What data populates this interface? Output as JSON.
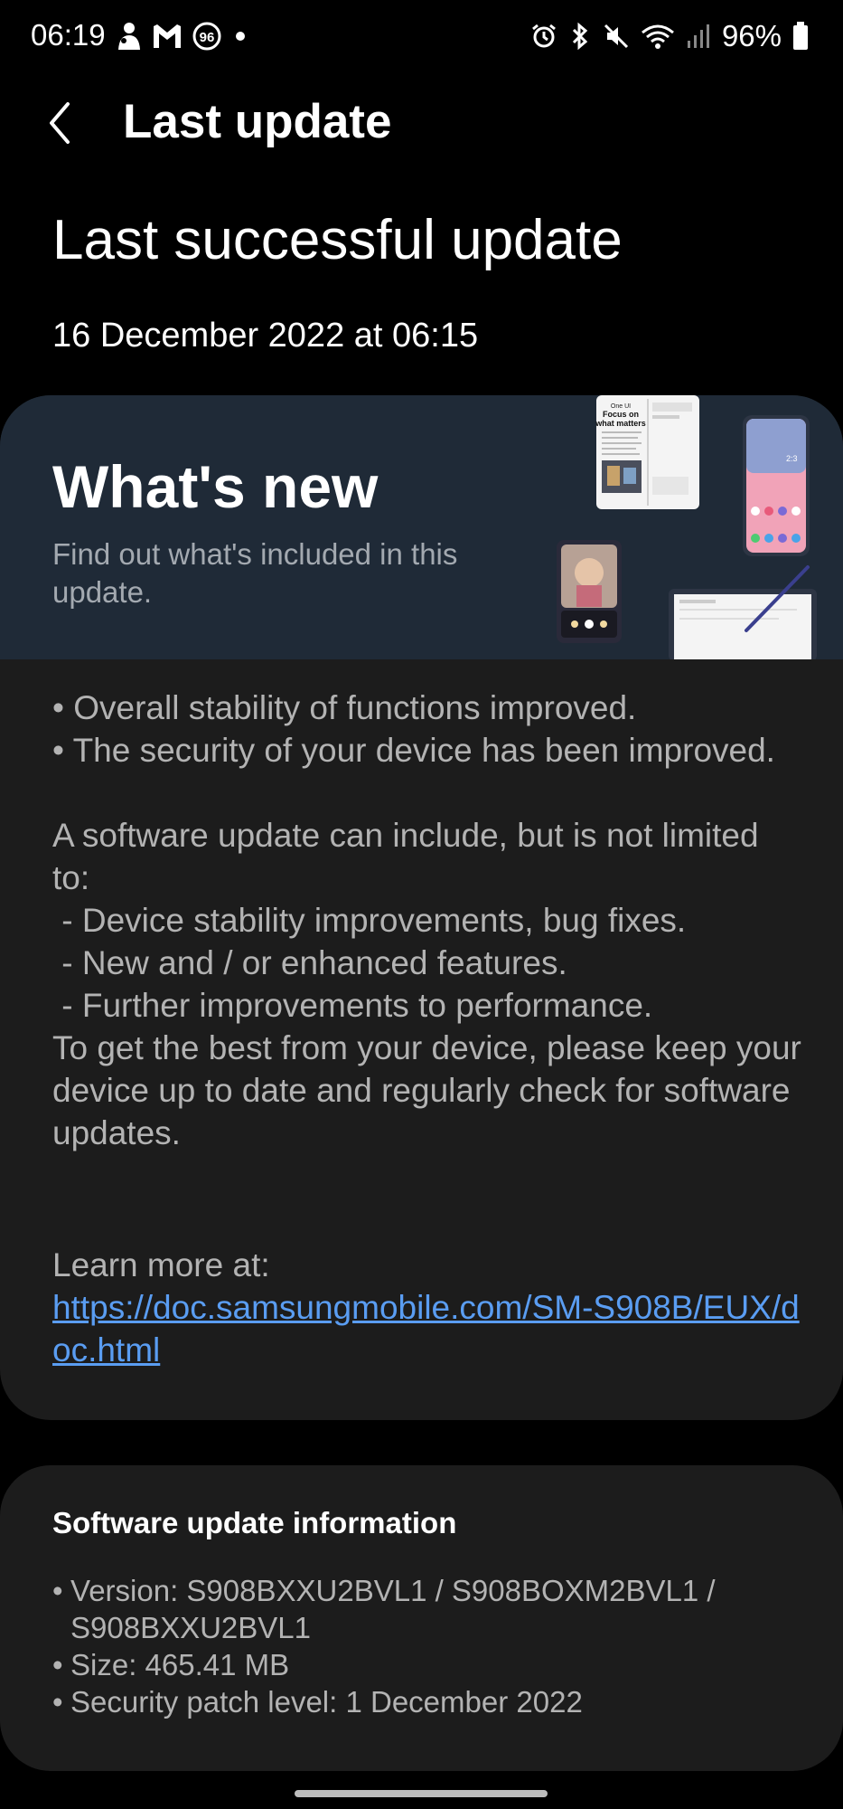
{
  "status_bar": {
    "time": "06:19",
    "notification_badge": "96",
    "battery": "96%",
    "icons": [
      "person-icon",
      "gmail-icon",
      "badge-icon",
      "dot-icon",
      "alarm-icon",
      "bluetooth-icon",
      "mute-icon",
      "wifi-icon",
      "signal-icon",
      "battery-icon"
    ]
  },
  "header": {
    "title": "Last update",
    "back_icon": "chevron-left-icon"
  },
  "last_update": {
    "heading": "Last successful update",
    "date": "16 December 2022 at 06:15"
  },
  "whats_new": {
    "title": "What's new",
    "subtitle": "Find out what's included in this update.",
    "promo_text": [
      "One UI",
      "Focus on",
      "what matters"
    ],
    "notes": "• Overall stability of functions improved.\n• The security of your device has been improved.\n\nA software update can include, but is not limited to:\n - Device stability improvements, bug fixes.\n - New and / or enhanced features.\n - Further improvements to performance.\nTo get the best from your device, please keep your device up to date and regularly check for software updates.",
    "learn_more_label": "Learn more at:",
    "learn_more_url": "https://doc.samsungmobile.com/SM-S908B/EUX/doc.html"
  },
  "software_info": {
    "title": "Software update information",
    "items": [
      "Version: S908BXXU2BVL1 / S908BOXM2BVL1 / S908BXXU2BVL1",
      "Size: 465.41 MB",
      "Security patch level: 1 December 2022"
    ]
  },
  "colors": {
    "background": "#000000",
    "card": "#1c1c1c",
    "banner": "#1f2a37",
    "link": "#5a9df2",
    "body_text": "#b3b3b3"
  }
}
